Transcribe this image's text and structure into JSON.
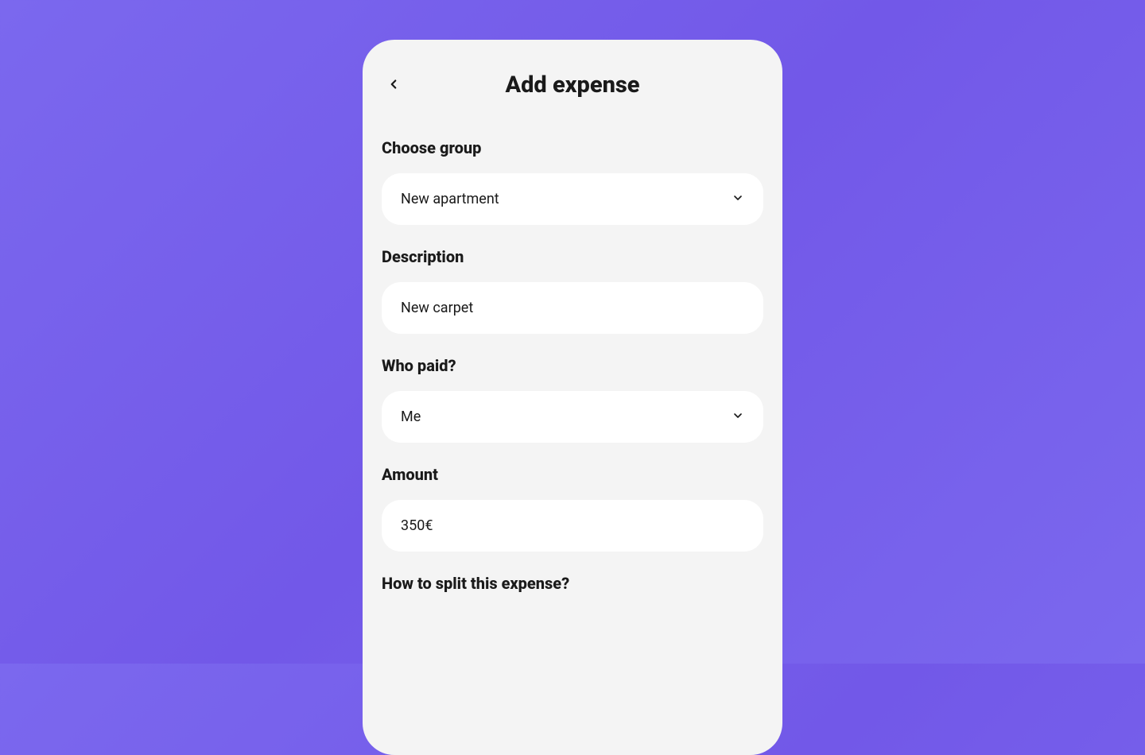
{
  "header": {
    "title": "Add expense"
  },
  "form": {
    "group": {
      "label": "Choose group",
      "value": "New apartment"
    },
    "description": {
      "label": "Description",
      "value": "New carpet"
    },
    "payer": {
      "label": "Who paid?",
      "value": "Me"
    },
    "amount": {
      "label": "Amount",
      "value": "350€"
    },
    "split": {
      "label": "How to split this expense?"
    }
  }
}
